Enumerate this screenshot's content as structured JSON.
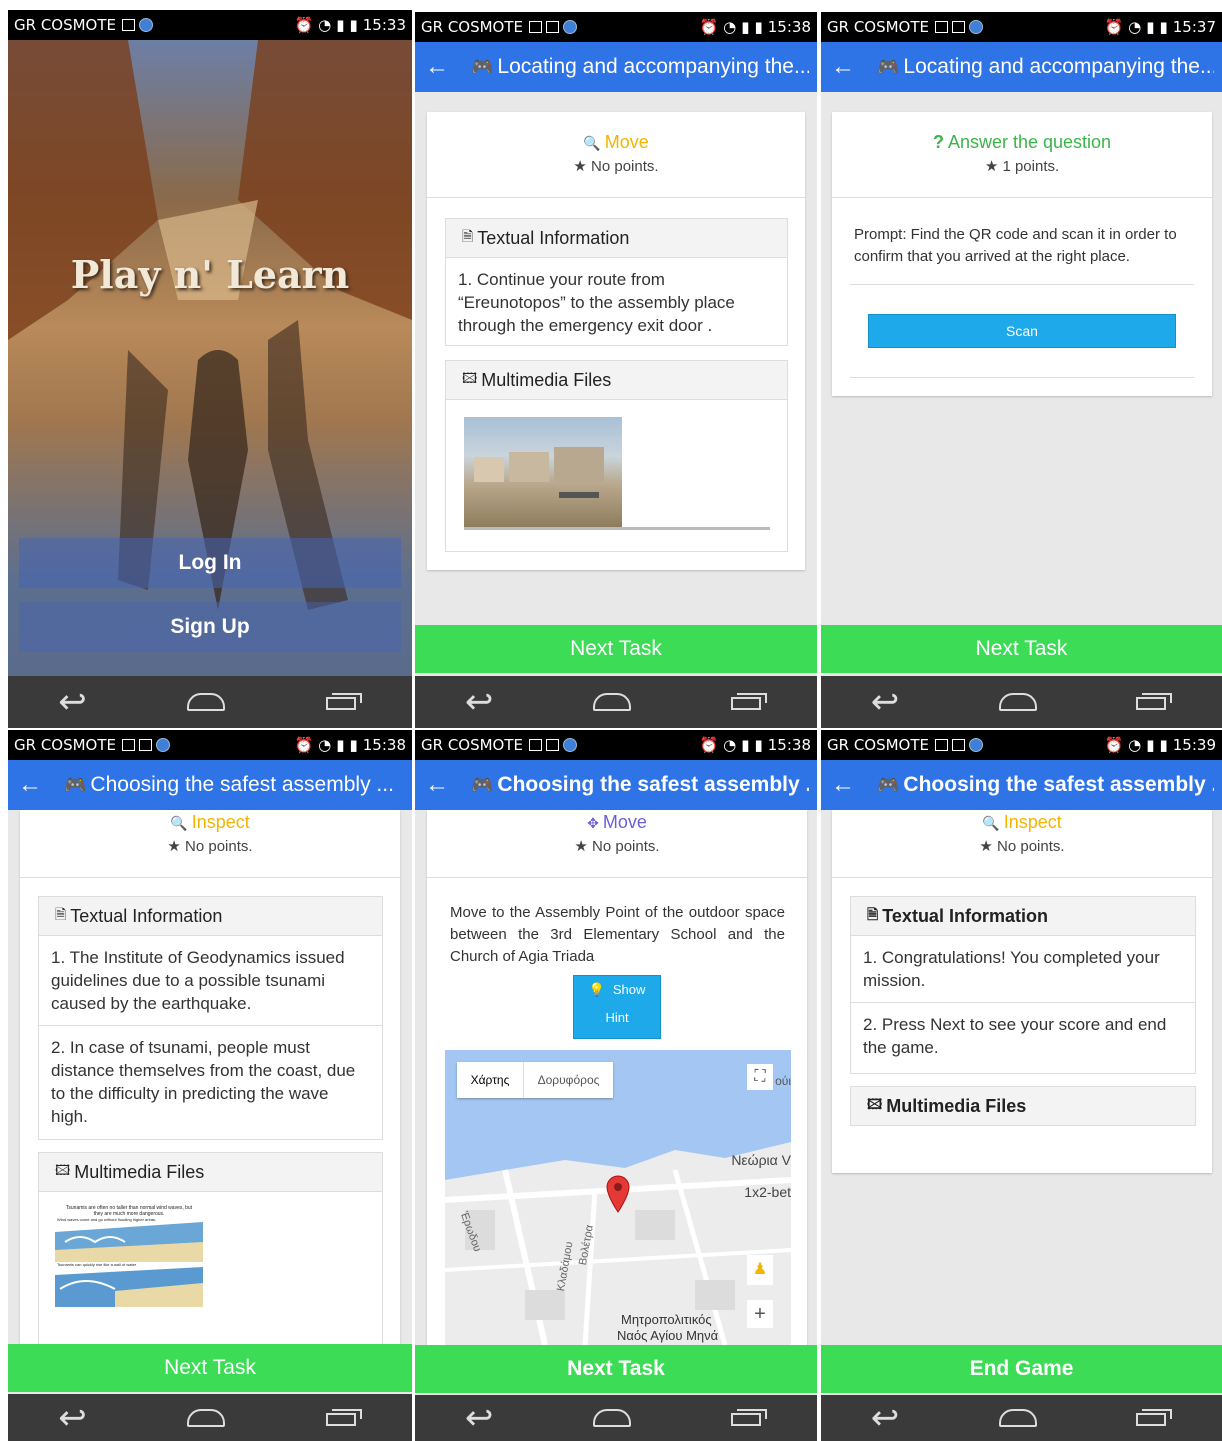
{
  "statusbar": {
    "carrier": "GR COSMOTE",
    "times": [
      "15:33",
      "15:38",
      "15:37",
      "15:38",
      "15:38",
      "15:39"
    ]
  },
  "screen1": {
    "app_title": "Play n' Learn",
    "login_label": "Log In",
    "signup_label": "Sign Up"
  },
  "screen2": {
    "header": "Locating and accompanying the...",
    "task_type": "Move",
    "task_points": "No points.",
    "textual_header": "Textual Information",
    "text_item": "1. Continue your route from “Ereunotopos” to the assembly place through the emergency exit door .",
    "multimedia_header": "Multimedia Files",
    "next_label": "Next Task"
  },
  "screen3": {
    "header": "Locating and accompanying the...",
    "task_type": "Answer the question",
    "task_points": "1 points.",
    "prompt": "Prompt: Find the QR code and scan it in order to confirm that you arrived at the right place.",
    "scan_label": "Scan",
    "next_label": "Next Task"
  },
  "screen4": {
    "header": "Choosing the safest assembly ...",
    "task_type": "Inspect",
    "task_points": "No points.",
    "textual_header": "Textual Information",
    "text_item_1": "1. The Institute of Geodynamics issued guidelines due to a possible tsunami caused by the earthquake.",
    "text_item_2": "2. In case of tsunami, people must distance themselves from the coast, due to the difficulty in predicting the wave high.",
    "multimedia_header": "Multimedia Files",
    "image_caption_1": "Tsunamis are often no taller than normal wind waves, but they are much more dangerous.",
    "image_caption_2": "Wind waves come and go without flooding higher areas.",
    "image_caption_3": "Tsunamis can quickly rise like a wall of water",
    "next_label": "Next Task"
  },
  "screen5": {
    "header": "Choosing the safest assembly ...",
    "task_type": "Move",
    "task_points": "No points.",
    "description": "Move to the Assembly Point of the outdoor space between the 3rd Elementary School and the Church of Agia Triada",
    "hint_label_1": "Show",
    "hint_label_2": "Hint",
    "map_tab_map": "Χάρτης",
    "map_tab_satellite": "Δορυφόρος",
    "map_labels": [
      "Νεώρια V",
      "1x2-bet",
      "Μητροπολιτικός",
      "Ναός Αγίου Μηνά",
      "Έρωδου",
      "Κλαδάμου",
      "Βολέτρα",
      "ούι"
    ],
    "zoom_in": "+",
    "next_label": "Next Task"
  },
  "screen6": {
    "header": "Choosing the safest assembly ...",
    "task_type": "Inspect",
    "task_points": "No points.",
    "textual_header": "Textual Information",
    "text_item_1": "1. Congratulations! You completed your mission.",
    "text_item_2": "2. Press Next to see your score and end the game.",
    "multimedia_header": "Multimedia Files",
    "end_label": "End Game"
  },
  "colors": {
    "appbar": "#2f74e6",
    "next_button": "#3ddc57",
    "move_orange": "#f5b400",
    "move_purple": "#6a5fd8",
    "answer_green": "#3bb54a",
    "scan_button": "#1eaaea"
  }
}
